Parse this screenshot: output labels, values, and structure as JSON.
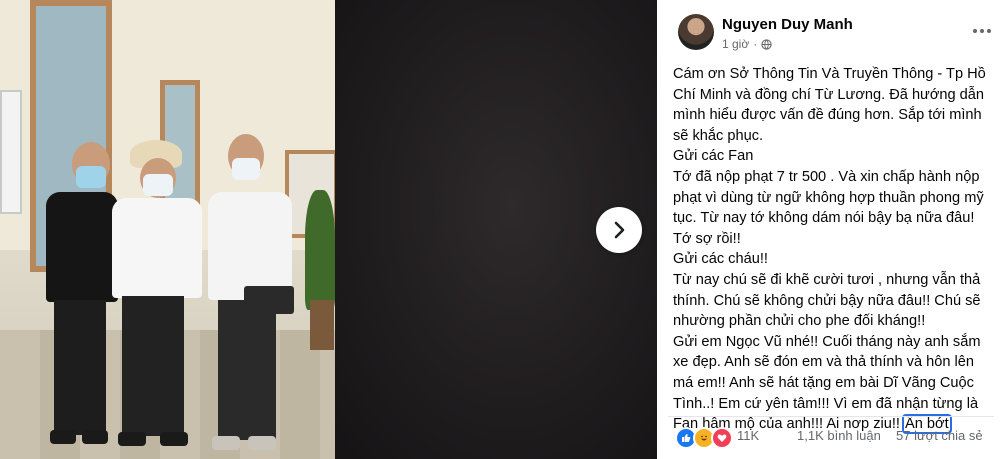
{
  "post": {
    "author": "Nguyen Duy Manh",
    "time": "1 giờ",
    "privacy_icon": "globe-icon",
    "more_icon": "more-horizontal-icon",
    "lines": [
      "Cám ơn Sở Thông Tin Và Truyền Thông - Tp Hồ",
      "Chí Minh và đồng chí Từ Lương. Đã hướng dẫn",
      "mình hiểu được vấn đề đúng hơn. Sắp tới mình",
      "sẽ khắc phục.",
      "Gửi các Fan",
      "Tớ đã nộp phạt 7 tr 500 . Và xin chấp hành nộp",
      "phạt vì dùng từ ngữ không hợp thuần phong mỹ",
      "tục. Từ nay tớ không dám nói bậy bạ nữa đâu!",
      "Tớ sợ rồi!!",
      "Gửi các cháu!!",
      "Từ nay chú sẽ đi khẽ cười tươi , nhưng vẫn thả",
      "thính. Chú sẽ không chửi bậy nữa đâu!! Chú sẽ",
      "nhường phần chửi cho phe đối kháng!!",
      "Gửi em Ngọc Vũ nhé!! Cuối tháng này anh sắm",
      "xe đẹp. Anh sẽ đón em và thả thính và hôn lên",
      "má em!! Anh sẽ hát tặng em bài Dĩ Vãng Cuộc",
      "Tình..! Em cứ yên tâm!!! Vì em đã nhận từng là",
      "Fan hâm mộ của anh!!! Ai nơp ziu!! "
    ],
    "see_less": "Ẩn bớt",
    "reaction_count": "11K",
    "comments": "1,1K bình luận",
    "shares": "57 lượt chia sẻ"
  },
  "viewer": {
    "next_icon": "chevron-right-icon"
  },
  "colors": {
    "link_outline": "#2a6ee6",
    "muted": "#65676b",
    "like": "#1877f2",
    "love": "#f33e58",
    "haha": "#f7b125"
  }
}
